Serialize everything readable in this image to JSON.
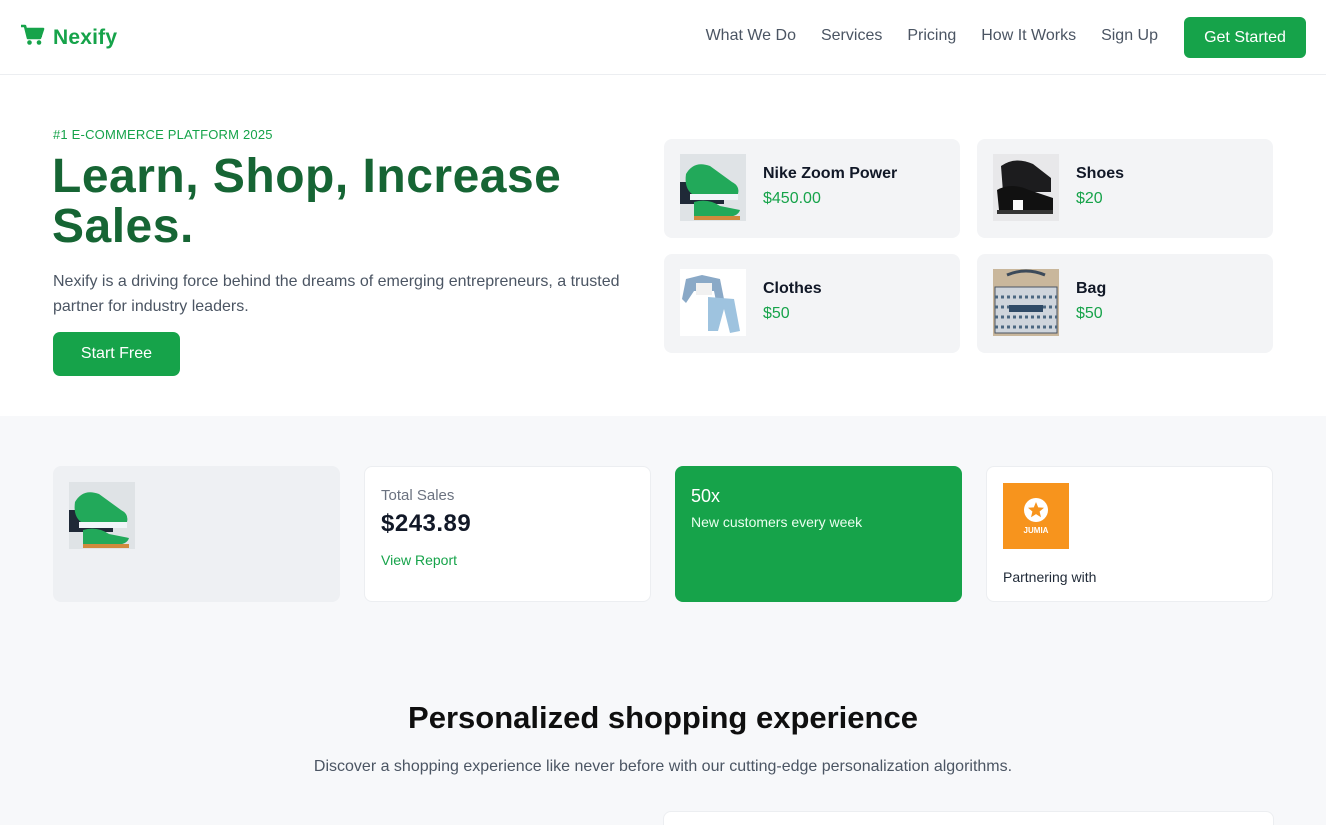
{
  "brand": {
    "name": "Nexify",
    "logo_icon": "cart-icon",
    "accent": "#16a34a"
  },
  "nav": {
    "links": [
      "What We Do",
      "Services",
      "Pricing",
      "How It Works",
      "Sign Up"
    ],
    "cta": "Get Started"
  },
  "hero": {
    "eyebrow": "#1 E-COMMERCE PLATFORM 2025",
    "title": "Learn, Shop, Increase Sales.",
    "subtitle": "Nexify is a driving force behind the dreams of emerging entrepreneurs, a trusted partner for industry leaders.",
    "cta": "Start Free"
  },
  "products": [
    {
      "name": "Nike Zoom Power",
      "price": "$450.00",
      "icon": "sneaker-image"
    },
    {
      "name": "Shoes",
      "price": "$20",
      "icon": "shoes-image"
    },
    {
      "name": "Clothes",
      "price": "$50",
      "icon": "clothes-image"
    },
    {
      "name": "Bag",
      "price": "$50",
      "icon": "bag-image"
    }
  ],
  "stats": {
    "sales_label": "Total Sales",
    "sales_value": "$243.89",
    "sales_link": "View Report",
    "multiplier": "50x",
    "multiplier_sub": "New customers every week",
    "partner_text": "Partnering with",
    "partner_logo_text": "JUMIA"
  },
  "section": {
    "title": "Personalized shopping experience",
    "subtitle": "Discover a shopping experience like never before with our cutting-edge personalization algorithms."
  }
}
